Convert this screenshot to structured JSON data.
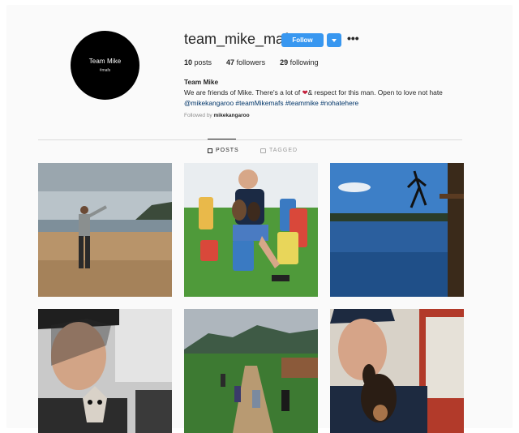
{
  "profile": {
    "avatar_name": "Team Mike",
    "avatar_tag": "#mafs",
    "username": "team_mike_mafs",
    "follow_label": "Follow",
    "more_label": "•••"
  },
  "stats": {
    "posts_count": "10",
    "posts_label": "posts",
    "followers_count": "47",
    "followers_label": "followers",
    "following_count": "29",
    "following_label": "following"
  },
  "bio": {
    "full_name": "Team Mike",
    "line1_a": "We are friends of Mike. There's a lot of ",
    "line1_heart": "❤",
    "line1_b": "& respect for this man. Open to love not hate",
    "line2_links": "@mikekangaroo #teamMikemafs #teammike #nohatehere",
    "followed_prefix": "Followed by ",
    "followed_by": "mikekangaroo"
  },
  "tabs": {
    "posts": "POSTS",
    "tagged": "TAGGED"
  },
  "posts": [
    {
      "icon": "beach-photo"
    },
    {
      "icon": "dogs-garden-photo"
    },
    {
      "icon": "lake-jump-photo"
    },
    {
      "icon": "car-selfie-photo"
    },
    {
      "icon": "village-road-photo"
    },
    {
      "icon": "dog-selfie-photo"
    }
  ],
  "colors": {
    "accent": "#3897f0",
    "link": "#003569",
    "muted": "#8e8e8e"
  }
}
